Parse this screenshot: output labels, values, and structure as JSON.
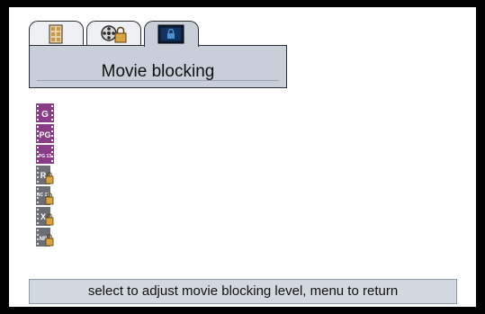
{
  "header": {
    "title": "Movie blocking"
  },
  "tabs": [
    {
      "icon": "grid-icon",
      "active": false
    },
    {
      "icon": "film-lock-icon",
      "active": false
    },
    {
      "icon": "lock-screen-icon",
      "active": true
    }
  ],
  "ratings": [
    {
      "label": "G",
      "locked": false
    },
    {
      "label": "PG",
      "locked": false
    },
    {
      "label": "PG 13",
      "locked": false
    },
    {
      "label": "R",
      "locked": true
    },
    {
      "label": "NC 17",
      "locked": true
    },
    {
      "label": "X",
      "locked": true
    },
    {
      "label": "NR",
      "locked": true
    }
  ],
  "footer": {
    "hint": "select to adjust movie blocking level, menu to return"
  },
  "colors": {
    "unlocked_icon": "#8a3d86",
    "locked_icon": "#6b6f75",
    "header_bg": "#c8cfd8",
    "footer_bg": "#d2d8df"
  }
}
